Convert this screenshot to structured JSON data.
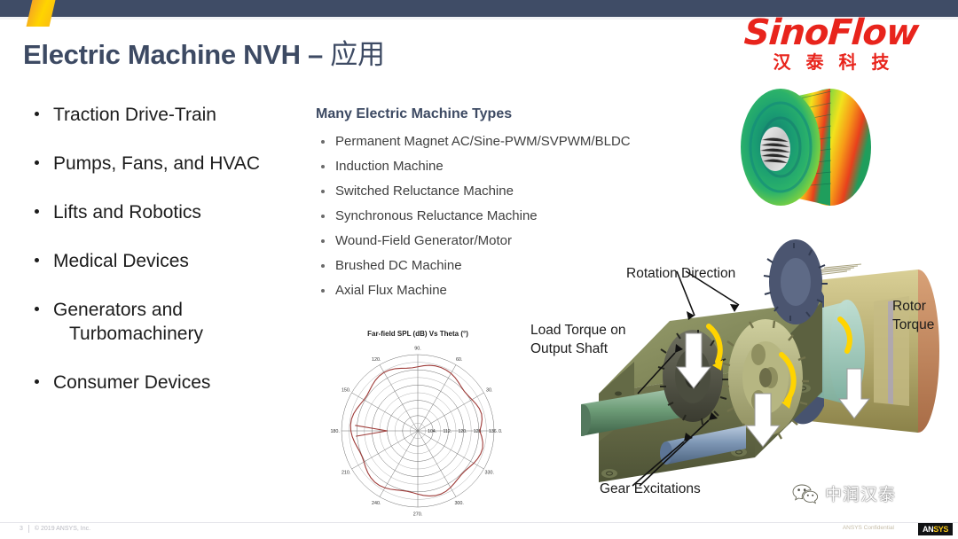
{
  "header": {
    "bar_color": "#3f4c66",
    "accent_color": "#ffc400"
  },
  "logo": {
    "name": "SinoFlow",
    "chinese_name": "汉 泰 科 技",
    "color": "#e8241c"
  },
  "title": {
    "english": "Electric Machine NVH – ",
    "chinese": "应用",
    "color": "#3d4a63"
  },
  "left_column": {
    "bullets": [
      {
        "line1": "Traction Drive-Train",
        "line2": ""
      },
      {
        "line1": "Pumps, Fans, and HVAC",
        "line2": ""
      },
      {
        "line1": "Lifts and Robotics",
        "line2": ""
      },
      {
        "line1": "Medical Devices",
        "line2": ""
      },
      {
        "line1": "Generators and",
        "line2": "Turbomachinery"
      },
      {
        "line1": "Consumer Devices",
        "line2": ""
      }
    ]
  },
  "middle_column": {
    "heading": "Many Electric Machine Types",
    "bullets": [
      "Permanent Magnet AC/Sine-PWM/SVPWM/BLDC",
      "Induction Machine",
      "Switched Reluctance Machine",
      "Synchronous Reluctance Machine",
      "Wound-Field Generator/Motor",
      "Brushed DC Machine",
      "Axial Flux Machine"
    ]
  },
  "chart_data": {
    "type": "line",
    "polar": true,
    "title": "Far-field SPL (dB) Vs Theta (°)",
    "xlabel": "Theta (°)",
    "ylabel": "Far-field SPL (dB)",
    "angle_ticks": [
      0,
      30,
      60,
      90,
      120,
      150,
      180,
      210,
      240,
      270,
      300,
      330
    ],
    "angle_tick_labels": [
      "0.",
      "30.",
      "60.",
      "90.",
      "120.",
      "150.",
      "180.",
      "210.",
      "240.",
      "270.",
      "300.",
      "330."
    ],
    "radial_ticks": [
      104,
      112,
      120,
      128,
      136
    ],
    "radial_tick_labels": [
      "104.",
      "112.",
      "120.",
      "128.",
      "136."
    ],
    "rlim": [
      96,
      136
    ],
    "grid": true,
    "legend": "none",
    "series": [
      {
        "name": "Far-field SPL",
        "color": "#9e3b38",
        "theta": [
          0,
          5,
          10,
          15,
          20,
          25,
          30,
          35,
          40,
          45,
          50,
          55,
          60,
          65,
          70,
          75,
          80,
          85,
          90,
          95,
          100,
          105,
          110,
          115,
          120,
          125,
          130,
          135,
          140,
          145,
          150,
          155,
          160,
          165,
          170,
          175,
          180,
          185,
          190,
          195,
          200,
          205,
          210,
          215,
          220,
          225,
          230,
          235,
          240,
          245,
          250,
          255,
          260,
          265,
          270,
          275,
          280,
          285,
          290,
          295,
          300,
          305,
          310,
          315,
          320,
          325,
          330,
          335,
          340,
          345,
          350,
          355
        ],
        "values": [
          128.5,
          129.4,
          130.2,
          130.6,
          130.3,
          129.6,
          128.8,
          128.2,
          128.0,
          128.4,
          129.2,
          130.1,
          130.8,
          131.2,
          131.4,
          131.3,
          130.9,
          130.3,
          129.6,
          129.2,
          129.4,
          130.0,
          130.7,
          131.2,
          131.4,
          131.2,
          130.6,
          129.8,
          129.0,
          128.5,
          128.6,
          129.2,
          130.0,
          130.8,
          131.3,
          131.4,
          131.1,
          130.5,
          129.7,
          128.9,
          128.3,
          128.2,
          128.6,
          129.4,
          130.2,
          130.8,
          131.1,
          131.0,
          130.5,
          129.8,
          129.0,
          128.4,
          128.2,
          128.5,
          129.2,
          130.0,
          130.7,
          131.2,
          131.3,
          131.0,
          130.3,
          129.5,
          128.8,
          128.4,
          128.5,
          129.1,
          129.9,
          130.6,
          131.1,
          131.2,
          130.6,
          129.6
        ],
        "notch_theta": 180,
        "notch_value": 112.0
      }
    ]
  },
  "annotations": {
    "rotation_direction": "Rotation Direction",
    "load_torque": "Load Torque on Output Shaft",
    "rotor_torque_line1": "Rotor",
    "rotor_torque_line2": "Torque",
    "gear_excitations": "Gear Excitations"
  },
  "images": {
    "stator_contour_name": "stator-deformation-contour",
    "gearbox_name": "motor-gearbox-assembly"
  },
  "watermark": {
    "icon": "wechat-icon",
    "text": "中润汉泰"
  },
  "footer": {
    "page_number": "3",
    "copyright": "© 2019 ANSYS, Inc.",
    "confidential": "ANSYS Confidential",
    "brand_part1": "AN",
    "brand_part2": "SYS"
  }
}
